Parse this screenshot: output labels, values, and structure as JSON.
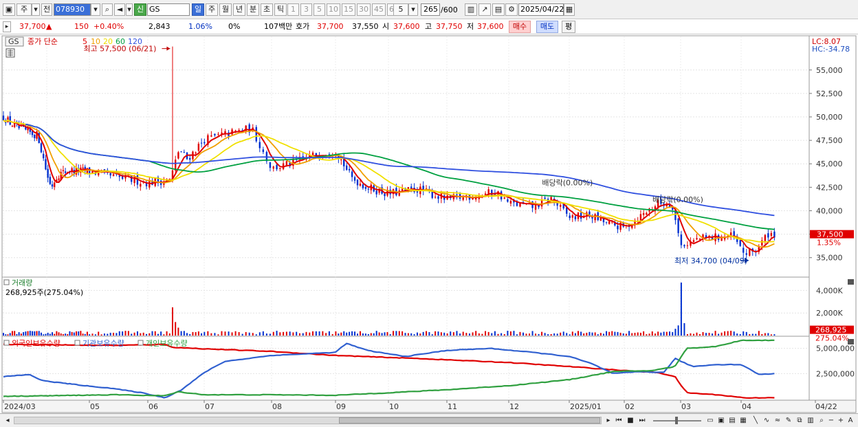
{
  "toolbar": {
    "market": "주",
    "prev_label": "전",
    "code": "078930",
    "search_mark": "신",
    "name": "GS",
    "periods": [
      "일",
      "주",
      "월",
      "년",
      "분",
      "초",
      "틱"
    ],
    "period_selected": "일",
    "intervals": [
      "1",
      "3",
      "5",
      "10",
      "15",
      "30",
      "45",
      "60"
    ],
    "interval_value": "5",
    "count": "265",
    "count_max": "/600",
    "date": "2025/04/22"
  },
  "quote": {
    "price": "37,700",
    "arrow": "▲",
    "change": "150",
    "change_pct": "+0.40%",
    "volume": "2,843",
    "turnover_pct": "1.06%",
    "zero_pct": "0%",
    "amount": "107백만",
    "hoga_label": "호가",
    "hoga": "37,700",
    "hoga2": "37,550",
    "open_label": "시",
    "open": "37,600",
    "high_label": "고",
    "high": "37,750",
    "low_label": "저",
    "low": "37,600",
    "buy_label": "매수",
    "sell_label": "매도",
    "eval_label": "평"
  },
  "price_panel": {
    "ticker": "GS",
    "legend_prefix": "종가 단순",
    "ma_periods": [
      "5",
      "10",
      "20",
      "60",
      "120"
    ],
    "ma_colors": [
      "#e00000",
      "#f0a000",
      "#f0e000",
      "#00a040",
      "#3050e0"
    ],
    "lc": "LC:8.07",
    "hc": "HC:-34.78",
    "high_label": "최고 57,500 (06/21)",
    "low_label": "최저 34,700 (04/09)",
    "div_label_1": "배당락(0.00%)",
    "div_label_2": "배당락(0.00%)",
    "last_price": "37,500",
    "last_pct": "1.35%"
  },
  "volume_panel": {
    "title": "거래량",
    "value": "268,925주(275.04%)",
    "last": "268,925",
    "last_pct": "275.04%"
  },
  "holdings_panel": {
    "legend": [
      "외국인보유수량",
      "기관보유수량",
      "개인보유수량"
    ],
    "colors": [
      "#e00000",
      "#3060d0",
      "#30a040"
    ]
  },
  "x_axis": {
    "labels": [
      "2024/03",
      "05",
      "06",
      "07",
      "08",
      "09",
      "10",
      "11",
      "12",
      "2025/01",
      "02",
      "03",
      "04",
      "04/22"
    ]
  },
  "chart_data": [
    {
      "type": "candlestick",
      "title": "GS",
      "ylim": [
        33000,
        58500
      ],
      "y_ticks": [
        "55,000",
        "52,500",
        "50,000",
        "47,500",
        "45,000",
        "42,500",
        "40,000",
        "37,500",
        "35,000"
      ],
      "x_months": [
        "2024/03",
        "04",
        "05",
        "06",
        "07",
        "08",
        "09",
        "10",
        "11",
        "12",
        "2025/01",
        "02",
        "03",
        "04"
      ],
      "close_anchors": [
        {
          "m": 0.0,
          "v": 50000
        },
        {
          "m": 0.25,
          "v": 49000
        },
        {
          "m": 0.5,
          "v": 48500
        },
        {
          "m": 0.8,
          "v": 48000
        },
        {
          "m": 1.0,
          "v": 44000
        },
        {
          "m": 1.1,
          "v": 42500
        },
        {
          "m": 1.25,
          "v": 43800
        },
        {
          "m": 1.5,
          "v": 44300
        },
        {
          "m": 2.0,
          "v": 44200
        },
        {
          "m": 2.5,
          "v": 43500
        },
        {
          "m": 3.0,
          "v": 43000
        },
        {
          "m": 3.4,
          "v": 43300
        },
        {
          "m": 3.55,
          "v": 46500
        },
        {
          "m": 3.7,
          "v": 45500
        },
        {
          "m": 4.0,
          "v": 47600
        },
        {
          "m": 4.4,
          "v": 48300
        },
        {
          "m": 4.7,
          "v": 48800
        },
        {
          "m": 5.0,
          "v": 44500
        },
        {
          "m": 5.3,
          "v": 45000
        },
        {
          "m": 5.6,
          "v": 45800
        },
        {
          "m": 6.0,
          "v": 46500
        },
        {
          "m": 6.3,
          "v": 43500
        },
        {
          "m": 6.6,
          "v": 42500
        },
        {
          "m": 7.0,
          "v": 41800
        },
        {
          "m": 7.5,
          "v": 42300
        },
        {
          "m": 8.0,
          "v": 41200
        },
        {
          "m": 8.4,
          "v": 41600
        },
        {
          "m": 8.8,
          "v": 42000
        },
        {
          "m": 9.0,
          "v": 40800
        },
        {
          "m": 9.4,
          "v": 40400
        },
        {
          "m": 9.7,
          "v": 41300
        },
        {
          "m": 10.0,
          "v": 39300
        },
        {
          "m": 10.4,
          "v": 39500
        },
        {
          "m": 10.7,
          "v": 38600
        },
        {
          "m": 11.0,
          "v": 38200
        },
        {
          "m": 11.3,
          "v": 39500
        },
        {
          "m": 11.6,
          "v": 40800
        },
        {
          "m": 11.85,
          "v": 40700
        },
        {
          "m": 12.0,
          "v": 36300
        },
        {
          "m": 12.3,
          "v": 37000
        },
        {
          "m": 12.6,
          "v": 37200
        },
        {
          "m": 12.85,
          "v": 37300
        },
        {
          "m": 13.05,
          "v": 35400
        },
        {
          "m": 13.25,
          "v": 35800
        },
        {
          "m": 13.45,
          "v": 37600
        },
        {
          "m": 13.55,
          "v": 37500
        }
      ],
      "high_marker": {
        "m": 3.42,
        "v": 57500
      },
      "low_marker": {
        "m": 13.05,
        "v": 34700
      }
    },
    {
      "type": "bar",
      "title": "거래량",
      "ylim": [
        0,
        5000000
      ],
      "y_ticks": [
        "4,000K",
        "2,000K"
      ],
      "spikes": [
        {
          "m": 3.42,
          "v": 4300000
        },
        {
          "m": 3.46,
          "v": 2500000
        },
        {
          "m": 3.5,
          "v": 1200000
        },
        {
          "m": 3.55,
          "v": 700000
        },
        {
          "m": 12.0,
          "v": 4700000
        },
        {
          "m": 11.96,
          "v": 900000
        },
        {
          "m": 12.04,
          "v": 1100000
        },
        {
          "m": 11.9,
          "v": 600000
        }
      ],
      "base_volume": 250000
    },
    {
      "type": "line",
      "title": "외국인보유수량",
      "ylim": [
        0,
        6000000
      ],
      "y_ticks": [
        "5,000,000",
        "2,500,000"
      ],
      "series": [
        {
          "name": "외국인보유수량",
          "color": "#e00000",
          "points": [
            {
              "m": 0,
              "v": 5400000
            },
            {
              "m": 2.5,
              "v": 5300000
            },
            {
              "m": 3.3,
              "v": 5400000
            },
            {
              "m": 3.45,
              "v": 5100000
            },
            {
              "m": 5,
              "v": 4700000
            },
            {
              "m": 6,
              "v": 4300000
            },
            {
              "m": 7.5,
              "v": 4000000
            },
            {
              "m": 9,
              "v": 3600000
            },
            {
              "m": 10,
              "v": 3200000
            },
            {
              "m": 11,
              "v": 2800000
            },
            {
              "m": 11.6,
              "v": 2600000
            },
            {
              "m": 11.9,
              "v": 2200000
            },
            {
              "m": 12.1,
              "v": 600000
            },
            {
              "m": 12.6,
              "v": 400000
            },
            {
              "m": 13.1,
              "v": 80000
            },
            {
              "m": 13.55,
              "v": 130000
            }
          ]
        },
        {
          "name": "기관보유수량",
          "color": "#3060d0",
          "points": [
            {
              "m": 0,
              "v": 2200000
            },
            {
              "m": 0.6,
              "v": 2400000
            },
            {
              "m": 0.9,
              "v": 1800000
            },
            {
              "m": 1.5,
              "v": 1500000
            },
            {
              "m": 2.3,
              "v": 1100000
            },
            {
              "m": 2.9,
              "v": 600000
            },
            {
              "m": 3.3,
              "v": 100000
            },
            {
              "m": 3.6,
              "v": 900000
            },
            {
              "m": 4,
              "v": 2600000
            },
            {
              "m": 4.3,
              "v": 3700000
            },
            {
              "m": 5,
              "v": 4300000
            },
            {
              "m": 6,
              "v": 4600000
            },
            {
              "m": 6.2,
              "v": 5500000
            },
            {
              "m": 6.6,
              "v": 4800000
            },
            {
              "m": 7.3,
              "v": 4200000
            },
            {
              "m": 8,
              "v": 4800000
            },
            {
              "m": 8.7,
              "v": 5000000
            },
            {
              "m": 9.4,
              "v": 4600000
            },
            {
              "m": 10,
              "v": 4200000
            },
            {
              "m": 10.4,
              "v": 3500000
            },
            {
              "m": 10.8,
              "v": 2500000
            },
            {
              "m": 11.3,
              "v": 2700000
            },
            {
              "m": 11.7,
              "v": 2600000
            },
            {
              "m": 11.9,
              "v": 4000000
            },
            {
              "m": 12.2,
              "v": 3200000
            },
            {
              "m": 12.6,
              "v": 3400000
            },
            {
              "m": 13.0,
              "v": 3400000
            },
            {
              "m": 13.3,
              "v": 2400000
            },
            {
              "m": 13.55,
              "v": 2500000
            }
          ]
        },
        {
          "name": "개인보유수량",
          "color": "#30a040",
          "points": [
            {
              "m": 0,
              "v": 250000
            },
            {
              "m": 1,
              "v": 300000
            },
            {
              "m": 2.5,
              "v": 400000
            },
            {
              "m": 3.3,
              "v": 300000
            },
            {
              "m": 3.55,
              "v": 700000
            },
            {
              "m": 4,
              "v": 400000
            },
            {
              "m": 5,
              "v": 400000
            },
            {
              "m": 6,
              "v": 350000
            },
            {
              "m": 7,
              "v": 600000
            },
            {
              "m": 8,
              "v": 900000
            },
            {
              "m": 9,
              "v": 1300000
            },
            {
              "m": 10,
              "v": 1900000
            },
            {
              "m": 10.8,
              "v": 2700000
            },
            {
              "m": 11.5,
              "v": 2800000
            },
            {
              "m": 11.9,
              "v": 3200000
            },
            {
              "m": 12.1,
              "v": 5000000
            },
            {
              "m": 12.6,
              "v": 5200000
            },
            {
              "m": 13.0,
              "v": 5800000
            },
            {
              "m": 13.55,
              "v": 5800000
            }
          ]
        }
      ]
    }
  ]
}
